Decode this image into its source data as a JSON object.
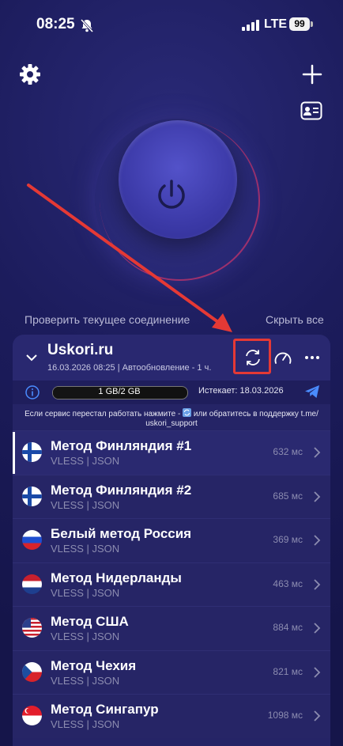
{
  "status": {
    "time": "08:25",
    "network": "LTE",
    "battery": "99"
  },
  "top": {
    "settings_icon": "gear-icon",
    "add_icon": "plus-icon",
    "profile_icon": "id-card-icon"
  },
  "power": {
    "icon": "power-icon"
  },
  "links": {
    "check_connection": "Проверить текущее соединение",
    "hide_all": "Скрыть все"
  },
  "subscription": {
    "name": "Uskori.ru",
    "date": "16.03.2026 08:25 | Автообновление - 1 ч.",
    "traffic": "1 GB/2 GB",
    "traffic_fraction": 0.5,
    "expires": "Истекает: 18.03.2026",
    "notice_line1": "Если сервис перестал работать нажмите -",
    "notice_line1b": "или обратитесь в поддержку t.me/",
    "notice_line2": "uskori_support"
  },
  "servers": [
    {
      "title": "Метод Финляндия #1",
      "sub": "VLESS | JSON",
      "ping": "632 мс",
      "flag": "fi"
    },
    {
      "title": "Метод Финляндия #2",
      "sub": "VLESS | JSON",
      "ping": "685 мс",
      "flag": "fi"
    },
    {
      "title": "Белый метод Россия",
      "sub": "VLESS | JSON",
      "ping": "369 мс",
      "flag": "ru"
    },
    {
      "title": "Метод Нидерланды",
      "sub": "VLESS | JSON",
      "ping": "463 мс",
      "flag": "nl"
    },
    {
      "title": "Метод США",
      "sub": "VLESS | JSON",
      "ping": "884 мс",
      "flag": "us"
    },
    {
      "title": "Метод Чехия",
      "sub": "VLESS | JSON",
      "ping": "821 мс",
      "flag": "cz"
    },
    {
      "title": "Метод Сингапур",
      "sub": "VLESS | JSON",
      "ping": "1098 мс",
      "flag": "sg"
    }
  ]
}
